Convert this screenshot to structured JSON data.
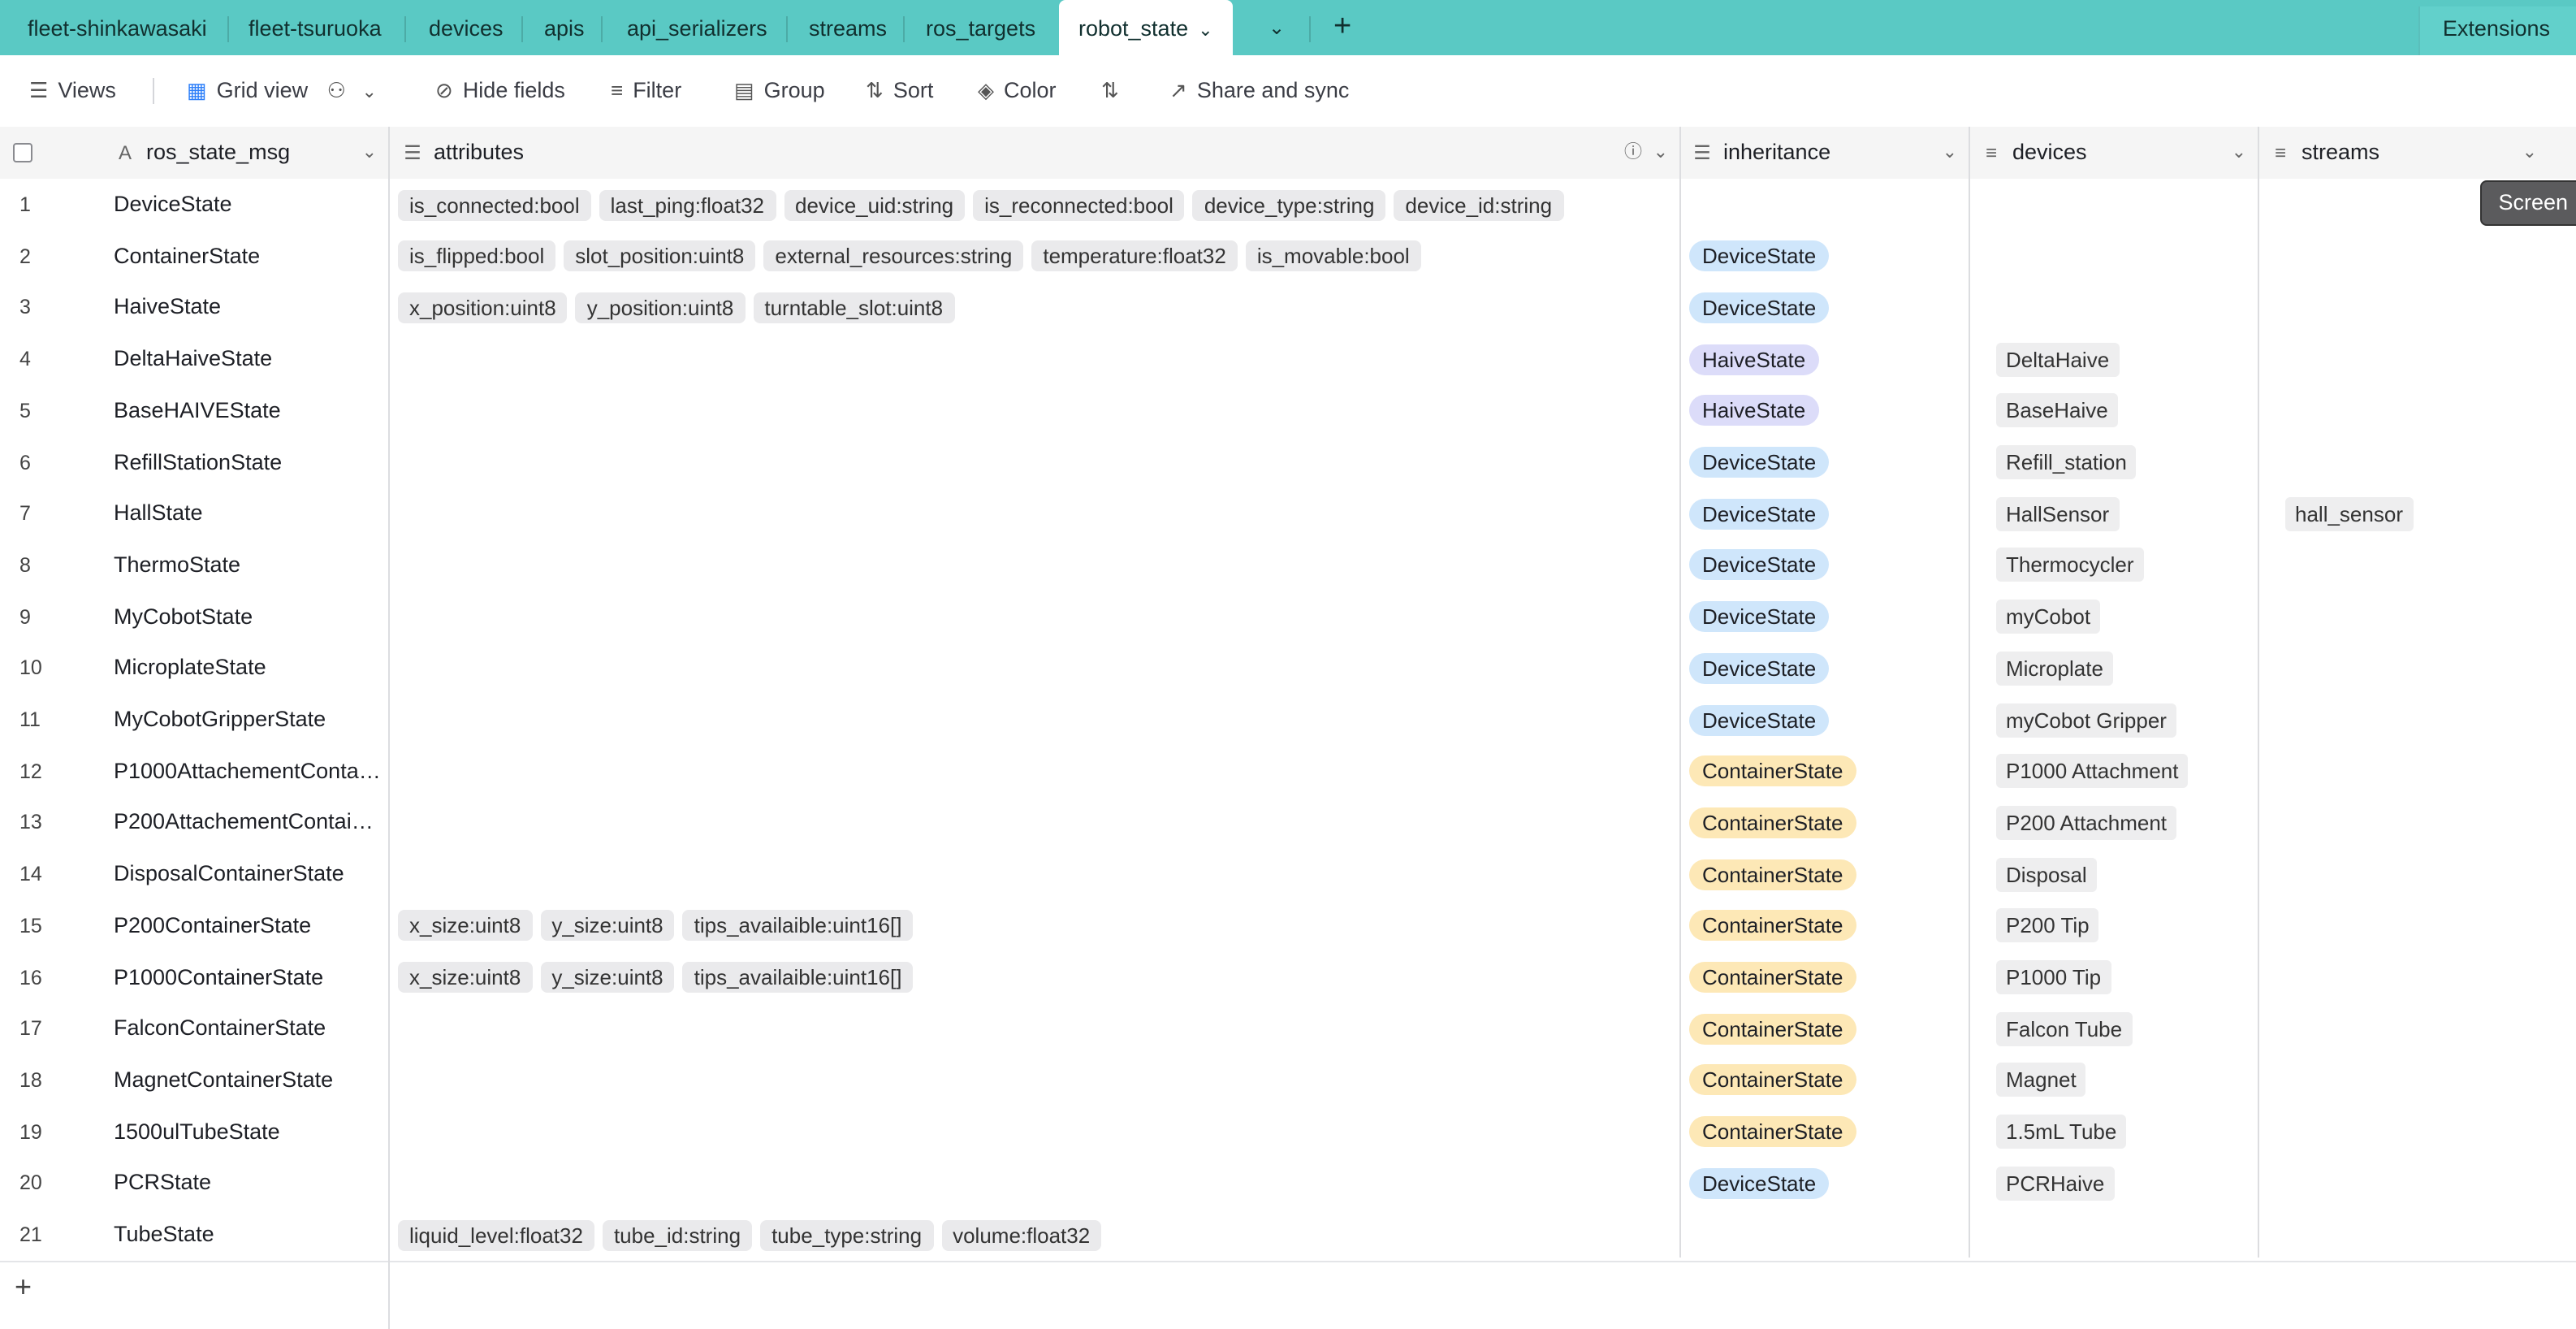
{
  "tabs": [
    {
      "label": "fleet-shinkawasaki"
    },
    {
      "label": "fleet-tsuruoka"
    },
    {
      "label": "devices"
    },
    {
      "label": "apis"
    },
    {
      "label": "api_serializers"
    },
    {
      "label": "streams"
    },
    {
      "label": "ros_targets"
    },
    {
      "label": "robot_state",
      "active": true
    }
  ],
  "extensions_label": "Extensions",
  "toolbar": {
    "views": "Views",
    "grid_view": "Grid view",
    "hide_fields": "Hide fields",
    "filter": "Filter",
    "group": "Group",
    "sort": "Sort",
    "color": "Color",
    "share": "Share and sync"
  },
  "columns": {
    "name": "ros_state_msg",
    "attributes": "attributes",
    "inheritance": "inheritance",
    "devices": "devices",
    "streams": "streams"
  },
  "rows": [
    {
      "n": "1",
      "name": "DeviceState",
      "attrs": [
        "is_connected:bool",
        "last_ping:float32",
        "device_uid:string",
        "is_reconnected:bool",
        "device_type:string",
        "device_id:string"
      ],
      "inherit": "",
      "inherit_type": "",
      "device": "",
      "stream": ""
    },
    {
      "n": "2",
      "name": "ContainerState",
      "attrs": [
        "is_flipped:bool",
        "slot_position:uint8",
        "external_resources:string",
        "temperature:float32",
        "is_movable:bool"
      ],
      "inherit": "DeviceState",
      "inherit_type": "device",
      "device": "",
      "stream": ""
    },
    {
      "n": "3",
      "name": "HaiveState",
      "attrs": [
        "x_position:uint8",
        "y_position:uint8",
        "turntable_slot:uint8"
      ],
      "inherit": "DeviceState",
      "inherit_type": "device",
      "device": "",
      "stream": ""
    },
    {
      "n": "4",
      "name": "DeltaHaiveState",
      "attrs": [],
      "inherit": "HaiveState",
      "inherit_type": "haive",
      "device": "DeltaHaive",
      "stream": ""
    },
    {
      "n": "5",
      "name": "BaseHAIVEState",
      "attrs": [],
      "inherit": "HaiveState",
      "inherit_type": "haive",
      "device": "BaseHaive",
      "stream": ""
    },
    {
      "n": "6",
      "name": "RefillStationState",
      "attrs": [],
      "inherit": "DeviceState",
      "inherit_type": "device",
      "device": "Refill_station",
      "stream": ""
    },
    {
      "n": "7",
      "name": "HallState",
      "attrs": [],
      "inherit": "DeviceState",
      "inherit_type": "device",
      "device": "HallSensor",
      "stream": "hall_sensor"
    },
    {
      "n": "8",
      "name": "ThermoState",
      "attrs": [],
      "inherit": "DeviceState",
      "inherit_type": "device",
      "device": "Thermocycler",
      "stream": ""
    },
    {
      "n": "9",
      "name": "MyCobotState",
      "attrs": [],
      "inherit": "DeviceState",
      "inherit_type": "device",
      "device": "myCobot",
      "stream": ""
    },
    {
      "n": "10",
      "name": "MicroplateState",
      "attrs": [],
      "inherit": "DeviceState",
      "inherit_type": "device",
      "device": "Microplate",
      "stream": ""
    },
    {
      "n": "11",
      "name": "MyCobotGripperState",
      "attrs": [],
      "inherit": "DeviceState",
      "inherit_type": "device",
      "device": "myCobot Gripper",
      "stream": ""
    },
    {
      "n": "12",
      "name": "P1000AttachementContai…",
      "attrs": [],
      "inherit": "ContainerState",
      "inherit_type": "container",
      "device": "P1000 Attachment",
      "stream": ""
    },
    {
      "n": "13",
      "name": "P200AttachementContain…",
      "attrs": [],
      "inherit": "ContainerState",
      "inherit_type": "container",
      "device": "P200 Attachment",
      "stream": ""
    },
    {
      "n": "14",
      "name": "DisposalContainerState",
      "attrs": [],
      "inherit": "ContainerState",
      "inherit_type": "container",
      "device": "Disposal",
      "stream": ""
    },
    {
      "n": "15",
      "name": "P200ContainerState",
      "attrs": [
        "x_size:uint8",
        "y_size:uint8",
        "tips_availaible:uint16[]"
      ],
      "inherit": "ContainerState",
      "inherit_type": "container",
      "device": "P200 Tip",
      "stream": ""
    },
    {
      "n": "16",
      "name": "P1000ContainerState",
      "attrs": [
        "x_size:uint8",
        "y_size:uint8",
        "tips_availaible:uint16[]"
      ],
      "inherit": "ContainerState",
      "inherit_type": "container",
      "device": "P1000 Tip",
      "stream": ""
    },
    {
      "n": "17",
      "name": "FalconContainerState",
      "attrs": [],
      "inherit": "ContainerState",
      "inherit_type": "container",
      "device": "Falcon Tube",
      "stream": ""
    },
    {
      "n": "18",
      "name": "MagnetContainerState",
      "attrs": [],
      "inherit": "ContainerState",
      "inherit_type": "container",
      "device": "Magnet",
      "stream": ""
    },
    {
      "n": "19",
      "name": "1500ulTubeState",
      "attrs": [],
      "inherit": "ContainerState",
      "inherit_type": "container",
      "device": "1.5mL Tube",
      "stream": ""
    },
    {
      "n": "20",
      "name": "PCRState",
      "attrs": [],
      "inherit": "DeviceState",
      "inherit_type": "device",
      "device": "PCRHaive",
      "stream": ""
    },
    {
      "n": "21",
      "name": "TubeState",
      "attrs": [
        "liquid_level:float32",
        "tube_id:string",
        "tube_type:string",
        "volume:float32"
      ],
      "inherit": "",
      "inherit_type": "",
      "device": "",
      "stream": ""
    }
  ],
  "overlay_label": "Screen",
  "icons": {
    "views": "hamburger-icon",
    "grid": "grid-view-icon",
    "collab": "collaborators-icon",
    "hide": "eye-slash-icon",
    "filter": "filter-icon",
    "group": "group-icon",
    "sort": "sort-icon",
    "color": "paint-bucket-icon",
    "rowheight": "row-height-icon",
    "share": "share-icon"
  },
  "colors": {
    "tabbar": "#5ac9c4",
    "pill_device": "#cfe6fb",
    "pill_haive": "#dcdcf9",
    "pill_container": "#fde8b6"
  }
}
